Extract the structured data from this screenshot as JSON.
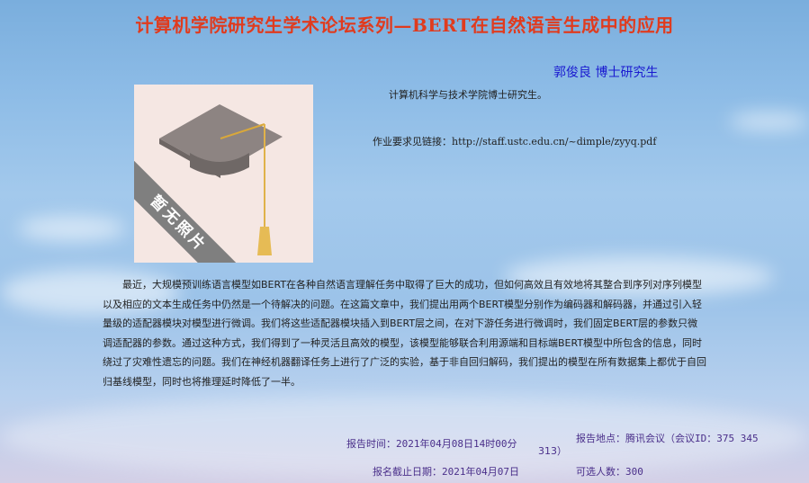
{
  "header": {
    "title": "计算机学院研究生学术论坛系列—BERT在自然语言生成中的应用"
  },
  "speaker": {
    "name_title": "郭俊良  博士研究生"
  },
  "photo": {
    "placeholder_text": "暂无照片"
  },
  "bio": {
    "text": "计算机科学与技术学院博士研究生。"
  },
  "homework": {
    "label": "作业要求见链接：",
    "url": "http://staff.ustc.edu.cn/~dimple/zyyq.pdf"
  },
  "abstract": {
    "text": "最近，大规模预训练语言模型如BERT在各种自然语言理解任务中取得了巨大的成功，但如何高效且有效地将其整合到序列对序列模型以及相应的文本生成任务中仍然是一个待解决的问题。在这篇文章中，我们提出用两个BERT模型分别作为编码器和解码器，并通过引入轻量级的适配器模块对模型进行微调。我们将这些适配器模块插入到BERT层之间，在对下游任务进行微调时，我们固定BERT层的参数只微调适配器的参数。通过这种方式，我们得到了一种灵活且高效的模型，该模型能够联合利用源端和目标端BERT模型中所包含的信息，同时绕过了灾难性遗忘的问题。我们在神经机器翻译任务上进行了广泛的实验，基于非自回归解码，我们提出的模型在所有数据集上都优于自回归基线模型，同时也将推理延时降低了一半。"
  },
  "info": {
    "time_label": "报告时间：",
    "time_value": "2021年04月08日14时00分",
    "location_label": "报告地点：",
    "location_value": "腾讯会议（会议ID：375 345",
    "location_cont": "313）",
    "deadline_label": "报名截止日期：",
    "deadline_value": "2021年04月07日",
    "capacity_label": "可选人数：",
    "capacity_value": "300"
  },
  "colors": {
    "title": "#e03b1e",
    "speaker": "#1a1ad0",
    "info": "#4a2f8a"
  }
}
